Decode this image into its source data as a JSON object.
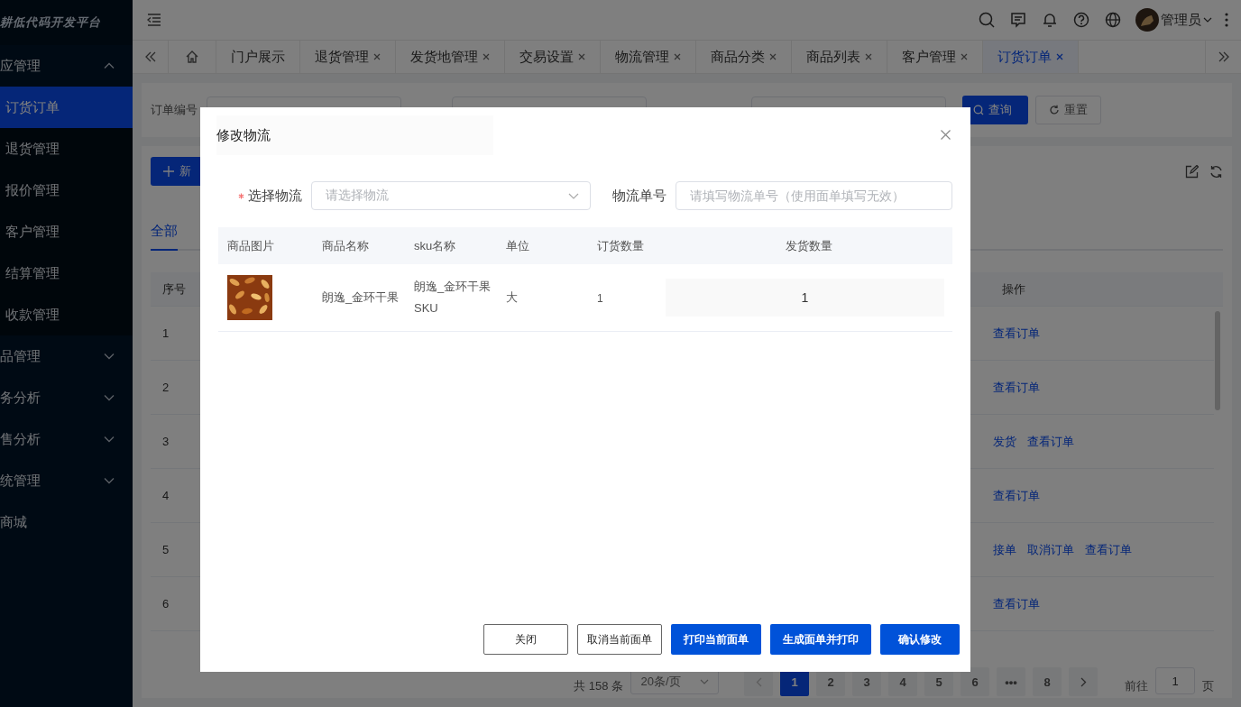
{
  "sidebar": {
    "logo": "耕低代码开发平台",
    "groups": [
      {
        "kind": "group",
        "label": "应管理",
        "expanded": true,
        "children": [
          {
            "label": "订货订单",
            "selected": true
          },
          {
            "label": "退货管理",
            "selected": false
          },
          {
            "label": "报价管理",
            "selected": false
          },
          {
            "label": "客户管理",
            "selected": false
          },
          {
            "label": "结算管理",
            "selected": false
          },
          {
            "label": "收款管理",
            "selected": false
          }
        ]
      },
      {
        "kind": "group",
        "label": "品管理",
        "expanded": false
      },
      {
        "kind": "group",
        "label": "务分析",
        "expanded": false
      },
      {
        "kind": "group",
        "label": "售分析",
        "expanded": false
      },
      {
        "kind": "group",
        "label": "统管理",
        "expanded": false
      },
      {
        "kind": "item",
        "label": "商城"
      }
    ]
  },
  "header": {
    "user": "管理员"
  },
  "tabs": [
    {
      "label": "门户展示",
      "closable": false,
      "selected": false
    },
    {
      "label": "退货管理",
      "closable": true,
      "selected": false
    },
    {
      "label": "发货地管理",
      "closable": true,
      "selected": false
    },
    {
      "label": "交易设置",
      "closable": true,
      "selected": false
    },
    {
      "label": "物流管理",
      "closable": true,
      "selected": false
    },
    {
      "label": "商品分类",
      "closable": true,
      "selected": false
    },
    {
      "label": "商品列表",
      "closable": true,
      "selected": false
    },
    {
      "label": "客户管理",
      "closable": true,
      "selected": false
    },
    {
      "label": "订货订单",
      "closable": true,
      "selected": true
    }
  ],
  "search": {
    "field_label": "订单编号",
    "buttons": [
      {
        "label": "查询",
        "kind": "primary"
      },
      {
        "label": "重置",
        "kind": "default"
      }
    ]
  },
  "toolbar": {
    "add_label": "新"
  },
  "status_tabs": [
    {
      "label": "全部",
      "selected": true
    }
  ],
  "orders": {
    "columns": [
      "序号",
      "操作"
    ],
    "rows": [
      {
        "index": "1",
        "actions": [
          "查看订单"
        ]
      },
      {
        "index": "2",
        "actions": [
          "查看订单"
        ]
      },
      {
        "index": "3",
        "actions": [
          "发货",
          "查看订单"
        ]
      },
      {
        "index": "4",
        "actions": [
          "查看订单"
        ]
      },
      {
        "index": "5",
        "actions": [
          "接单",
          "取消订单",
          "查看订单"
        ]
      },
      {
        "index": "6",
        "actions": [
          "查看订单"
        ]
      }
    ]
  },
  "pagination": {
    "total": "共 158 条",
    "page_size": "20条/页",
    "pages": [
      {
        "label": "1",
        "selected": true
      },
      {
        "label": "2",
        "selected": false
      },
      {
        "label": "3",
        "selected": false
      },
      {
        "label": "4",
        "selected": false
      },
      {
        "label": "5",
        "selected": false
      },
      {
        "label": "6",
        "selected": false
      },
      {
        "label": "•••",
        "selected": false
      },
      {
        "label": "8",
        "selected": false
      }
    ],
    "jump_label": "前往",
    "jump_value": "1",
    "page_suffix": "页"
  },
  "modal": {
    "title": "修改物流",
    "form": [
      {
        "kind": "select",
        "label": "选择物流",
        "required": true,
        "placeholder": "请选择物流"
      },
      {
        "kind": "input",
        "label": "物流单号",
        "required": false,
        "placeholder": "请填写物流单号（使用面单填写无效）"
      }
    ],
    "table": {
      "columns": [
        "商品图片",
        "商品名称",
        "sku名称",
        "单位",
        "订货数量",
        "发货数量"
      ],
      "rows": [
        {
          "name": "朗逸_金环干果",
          "sku": "朗逸_金环干果SKU",
          "unit": "大",
          "ordered": "1",
          "shipped": "1"
        }
      ]
    },
    "buttons": [
      {
        "label": "关闭",
        "kind": "default"
      },
      {
        "label": "取消当前面单",
        "kind": "default"
      },
      {
        "label": "打印当前面单",
        "kind": "primary"
      },
      {
        "label": "生成面单并打印",
        "kind": "primary"
      },
      {
        "label": "确认修改",
        "kind": "primary"
      }
    ]
  }
}
